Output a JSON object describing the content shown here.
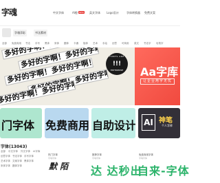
{
  "header": {
    "logo": "字魂",
    "nav": [
      {
        "label": "中文字体",
        "badge": ""
      },
      {
        "label": "AI橙",
        "badge": "NEW"
      },
      {
        "label": "英文字体",
        "badge": ""
      },
      {
        "label": "Logo设计",
        "badge": ""
      },
      {
        "label": "字体转换器",
        "badge": ""
      },
      {
        "label": "免费文案",
        "badge": ""
      }
    ]
  },
  "subbar": {
    "buttons": [
      "字魂添彩",
      "书法素材"
    ]
  },
  "categories": [
    "全部",
    "免费商用",
    "书法",
    "手写",
    "黑体",
    "宋体",
    "圆体",
    "卡通",
    "楷体",
    "艺术",
    "手绘",
    "创意",
    "可商用",
    "英文",
    "书法字",
    "毛笔字"
  ],
  "banner": {
    "strip_text": "多好的字啊！多好的字啊！",
    "seal_top": "FONTS ARE",
    "seal_mark": "!!!",
    "seal_bottom": "ENTERPRISE",
    "right_title": "Aa字库",
    "right_sub": "让企业用字无忧"
  },
  "tiles": [
    {
      "text": "门字体",
      "bg": "#aee6cf"
    },
    {
      "text": "免费商用",
      "bg": "#b9d8ef"
    },
    {
      "text": "自助设计",
      "bg": "#bfeee6"
    },
    {
      "ai": "AI",
      "t1": "神笔",
      "t2": "个人字库",
      "bg": "#333038"
    }
  ],
  "section": {
    "title": "字体(13043)",
    "filters": [
      "全部",
      "中文字体",
      "外文字体",
      "AI字库",
      "创意字体",
      "书法字体",
      "手写字体",
      "艺术字体",
      "文案字体",
      "黑体字体",
      "宋体字体",
      "圆体字体"
    ],
    "cards": [
      {
        "tag": "热门字体",
        "sub": "字魂字体",
        "script": "默 陌 "
      },
      {
        "tag": "推荐字体",
        "sub": "字魂字体",
        "cta": "达 达秒出"
      },
      {
        "tag": "免费商用字体",
        "sub": "字魂字体",
        "cta": "自来-字体"
      }
    ]
  },
  "colors": {
    "accent": "#e6322d",
    "banner_red": "#f04a3f",
    "cta_green": "#2bb36a"
  }
}
